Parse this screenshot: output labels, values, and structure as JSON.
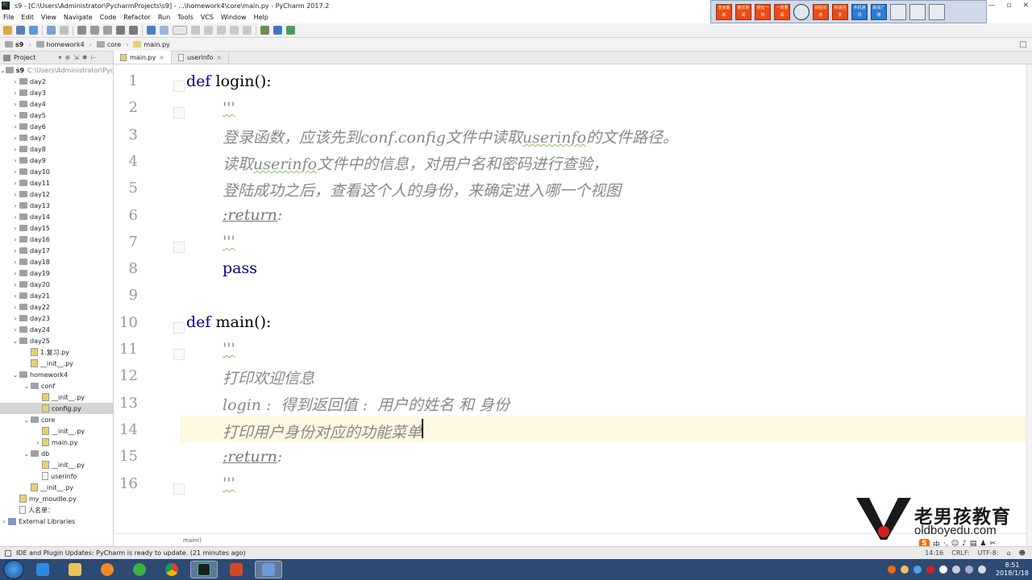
{
  "window": {
    "title": "s9 - [C:\\Users\\Administrator\\PycharmProjects\\s9] - ...\\homework4\\core\\main.py - PyCharm 2017.2",
    "app_icon_label": "PC",
    "controls": [
      "—",
      "▫",
      "✕"
    ]
  },
  "title_tools": [
    "亚洲最新",
    "娱乐新闻",
    "轻松一刻",
    "一周要闻",
    "世界新闻",
    "财经动态",
    "快速回复",
    "手机通讯",
    "新闻广播"
  ],
  "menu": [
    "File",
    "Edit",
    "View",
    "Navigate",
    "Code",
    "Refactor",
    "Run",
    "Tools",
    "VCS",
    "Window",
    "Help"
  ],
  "navbar": {
    "crumbs": [
      "s9",
      "homework4",
      "core",
      "main.py"
    ]
  },
  "project_panel": {
    "header_label": "Project",
    "root_label": "s9",
    "root_path": "C:\\Users\\Administrator\\PycharmProjects\\s9",
    "items": [
      {
        "label": "day2",
        "type": "folder",
        "depth": 1,
        "arrow": "›"
      },
      {
        "label": "day3",
        "type": "folder",
        "depth": 1,
        "arrow": "›"
      },
      {
        "label": "day4",
        "type": "folder",
        "depth": 1,
        "arrow": "›"
      },
      {
        "label": "day5",
        "type": "folder",
        "depth": 1,
        "arrow": "›"
      },
      {
        "label": "day6",
        "type": "folder",
        "depth": 1,
        "arrow": "›"
      },
      {
        "label": "day7",
        "type": "folder",
        "depth": 1,
        "arrow": "›"
      },
      {
        "label": "day8",
        "type": "folder",
        "depth": 1,
        "arrow": "›"
      },
      {
        "label": "day9",
        "type": "folder",
        "depth": 1,
        "arrow": "›"
      },
      {
        "label": "day10",
        "type": "folder",
        "depth": 1,
        "arrow": "›"
      },
      {
        "label": "day11",
        "type": "folder",
        "depth": 1,
        "arrow": "›"
      },
      {
        "label": "day12",
        "type": "folder",
        "depth": 1,
        "arrow": "›"
      },
      {
        "label": "day13",
        "type": "folder",
        "depth": 1,
        "arrow": "›"
      },
      {
        "label": "day14",
        "type": "folder",
        "depth": 1,
        "arrow": "›"
      },
      {
        "label": "day15",
        "type": "folder",
        "depth": 1,
        "arrow": "›"
      },
      {
        "label": "day16",
        "type": "folder",
        "depth": 1,
        "arrow": "›"
      },
      {
        "label": "day17",
        "type": "folder",
        "depth": 1,
        "arrow": "›"
      },
      {
        "label": "day18",
        "type": "folder",
        "depth": 1,
        "arrow": "›"
      },
      {
        "label": "day19",
        "type": "folder",
        "depth": 1,
        "arrow": "›"
      },
      {
        "label": "day20",
        "type": "folder",
        "depth": 1,
        "arrow": "›"
      },
      {
        "label": "day21",
        "type": "folder",
        "depth": 1,
        "arrow": "›"
      },
      {
        "label": "day22",
        "type": "folder",
        "depth": 1,
        "arrow": "›"
      },
      {
        "label": "day23",
        "type": "folder",
        "depth": 1,
        "arrow": "›"
      },
      {
        "label": "day24",
        "type": "folder",
        "depth": 1,
        "arrow": "›"
      },
      {
        "label": "day25",
        "type": "folder",
        "depth": 1,
        "arrow": "⌄"
      },
      {
        "label": "1.复习.py",
        "type": "py",
        "depth": 2,
        "arrow": ""
      },
      {
        "label": "__init__.py",
        "type": "py",
        "depth": 2,
        "arrow": ""
      },
      {
        "label": "homework4",
        "type": "folder",
        "depth": 1,
        "arrow": "⌄"
      },
      {
        "label": "conf",
        "type": "folder",
        "depth": 2,
        "arrow": "⌄"
      },
      {
        "label": "__init__.py",
        "type": "py",
        "depth": 3,
        "arrow": ""
      },
      {
        "label": "config.py",
        "type": "py",
        "depth": 3,
        "arrow": "",
        "selected": true
      },
      {
        "label": "core",
        "type": "folder",
        "depth": 2,
        "arrow": "⌄"
      },
      {
        "label": "__init__.py",
        "type": "py",
        "depth": 3,
        "arrow": ""
      },
      {
        "label": "main.py",
        "type": "py",
        "depth": 3,
        "arrow": "›"
      },
      {
        "label": "db",
        "type": "folder",
        "depth": 2,
        "arrow": "⌄"
      },
      {
        "label": "__init__.py",
        "type": "py",
        "depth": 3,
        "arrow": ""
      },
      {
        "label": "userinfo",
        "type": "txt",
        "depth": 3,
        "arrow": ""
      },
      {
        "label": "__init__.py",
        "type": "py",
        "depth": 2,
        "arrow": ""
      },
      {
        "label": "my_moudle.py",
        "type": "py",
        "depth": 1,
        "arrow": ""
      },
      {
        "label": "人名单：",
        "type": "txt",
        "depth": 1,
        "arrow": ""
      },
      {
        "label": "External Libraries",
        "type": "lib",
        "depth": 0,
        "arrow": "›"
      }
    ]
  },
  "editor_tabs": [
    {
      "label": "main.py",
      "icon": "py",
      "active": true
    },
    {
      "label": "userinfo",
      "icon": "txt",
      "active": false
    }
  ],
  "code": {
    "line_numbers": [
      "1",
      "2",
      "3",
      "4",
      "5",
      "6",
      "7",
      "8",
      "9",
      "10",
      "11",
      "12",
      "13",
      "14",
      "15",
      "16"
    ],
    "l1_kw": "def",
    "l1_rest": " login():",
    "l2": "'''",
    "l3_a": "登录函数，应该先到",
    "l3_b": "conf",
    "l3_c": ".",
    "l3_d": "config",
    "l3_e": "文件中读取",
    "l3_f": "userinfo",
    "l3_g": "的文件路径。",
    "l4_a": "读取",
    "l4_b": "userinfo",
    "l4_c": "文件中的信息，对用户名和密码进行查验，",
    "l5": "登陆成功之后，查看这个人的身份，来确定进入哪一个视图",
    "l6_a": ":return",
    "l6_b": ":",
    "l7": "'''",
    "l8": "pass",
    "l10_kw": "def",
    "l10_rest": " main():",
    "l11": "'''",
    "l12": "打印欢迎信息",
    "l13": "login :  得到返回值 :  用户的姓名 和 身份",
    "l14": "打印用户身份对应的功能菜单",
    "l15_a": ":return",
    "l15_b": ":",
    "l16": "'''"
  },
  "editor_breadcrumb": "main()",
  "watermark": {
    "text": "老男孩教育",
    "url": "oldboyedu.com"
  },
  "status": {
    "message": "IDE and Plugin Updates: PyCharm is ready to update. (21 minutes ago)",
    "position": "14:16",
    "line_sep": "CRLF:",
    "encoding": "UTF-8:"
  },
  "ime": {
    "logo": "S",
    "mode": "中"
  },
  "clock": {
    "time": "8:51",
    "date": "2018/1/18"
  }
}
